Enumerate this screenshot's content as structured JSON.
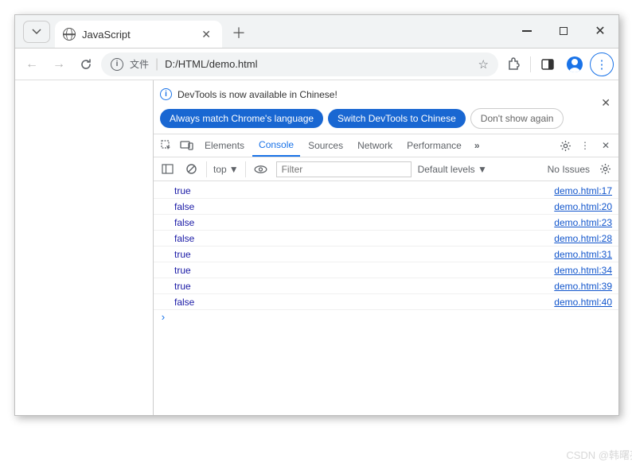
{
  "tab": {
    "title": "JavaScript"
  },
  "addressbar": {
    "scheme_label": "文件",
    "url": "D:/HTML/demo.html"
  },
  "banner": {
    "message": "DevTools is now available in Chinese!",
    "btn_match": "Always match Chrome's language",
    "btn_switch": "Switch DevTools to Chinese",
    "btn_dont": "Don't show again"
  },
  "devtools_tabs": {
    "elements": "Elements",
    "console": "Console",
    "sources": "Sources",
    "network": "Network",
    "performance": "Performance"
  },
  "filterbar": {
    "context": "top",
    "filter_placeholder": "Filter",
    "levels": "Default levels",
    "issues": "No Issues"
  },
  "console": {
    "rows": [
      {
        "value": "true",
        "source": "demo.html:17"
      },
      {
        "value": "false",
        "source": "demo.html:20"
      },
      {
        "value": "false",
        "source": "demo.html:23"
      },
      {
        "value": "false",
        "source": "demo.html:28"
      },
      {
        "value": "true",
        "source": "demo.html:31"
      },
      {
        "value": "true",
        "source": "demo.html:34"
      },
      {
        "value": "true",
        "source": "demo.html:39"
      },
      {
        "value": "false",
        "source": "demo.html:40"
      }
    ]
  },
  "watermark": "CSDN @韩曙亮"
}
